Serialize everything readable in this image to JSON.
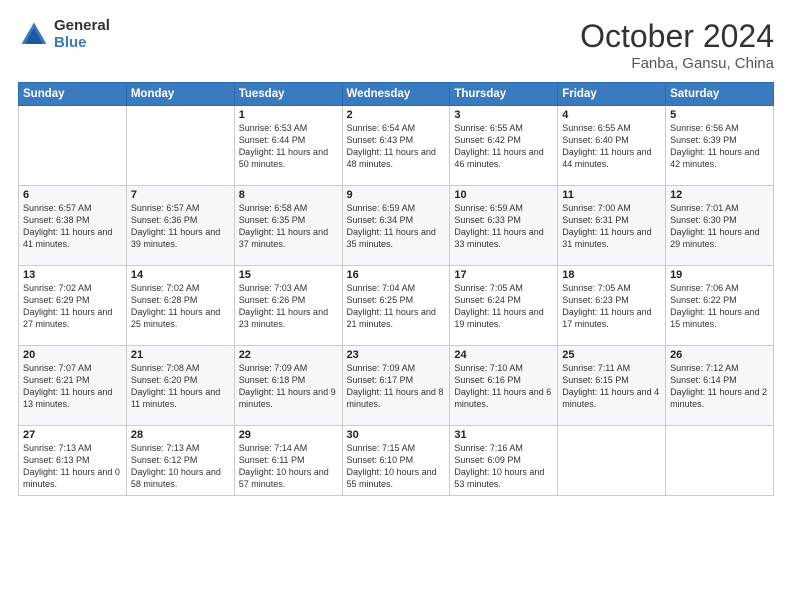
{
  "header": {
    "logo_general": "General",
    "logo_blue": "Blue",
    "month": "October 2024",
    "location": "Fanba, Gansu, China"
  },
  "days_of_week": [
    "Sunday",
    "Monday",
    "Tuesday",
    "Wednesday",
    "Thursday",
    "Friday",
    "Saturday"
  ],
  "weeks": [
    [
      {
        "day": "",
        "content": ""
      },
      {
        "day": "",
        "content": ""
      },
      {
        "day": "1",
        "content": "Sunrise: 6:53 AM\nSunset: 6:44 PM\nDaylight: 11 hours and 50 minutes."
      },
      {
        "day": "2",
        "content": "Sunrise: 6:54 AM\nSunset: 6:43 PM\nDaylight: 11 hours and 48 minutes."
      },
      {
        "day": "3",
        "content": "Sunrise: 6:55 AM\nSunset: 6:42 PM\nDaylight: 11 hours and 46 minutes."
      },
      {
        "day": "4",
        "content": "Sunrise: 6:55 AM\nSunset: 6:40 PM\nDaylight: 11 hours and 44 minutes."
      },
      {
        "day": "5",
        "content": "Sunrise: 6:56 AM\nSunset: 6:39 PM\nDaylight: 11 hours and 42 minutes."
      }
    ],
    [
      {
        "day": "6",
        "content": "Sunrise: 6:57 AM\nSunset: 6:38 PM\nDaylight: 11 hours and 41 minutes."
      },
      {
        "day": "7",
        "content": "Sunrise: 6:57 AM\nSunset: 6:36 PM\nDaylight: 11 hours and 39 minutes."
      },
      {
        "day": "8",
        "content": "Sunrise: 6:58 AM\nSunset: 6:35 PM\nDaylight: 11 hours and 37 minutes."
      },
      {
        "day": "9",
        "content": "Sunrise: 6:59 AM\nSunset: 6:34 PM\nDaylight: 11 hours and 35 minutes."
      },
      {
        "day": "10",
        "content": "Sunrise: 6:59 AM\nSunset: 6:33 PM\nDaylight: 11 hours and 33 minutes."
      },
      {
        "day": "11",
        "content": "Sunrise: 7:00 AM\nSunset: 6:31 PM\nDaylight: 11 hours and 31 minutes."
      },
      {
        "day": "12",
        "content": "Sunrise: 7:01 AM\nSunset: 6:30 PM\nDaylight: 11 hours and 29 minutes."
      }
    ],
    [
      {
        "day": "13",
        "content": "Sunrise: 7:02 AM\nSunset: 6:29 PM\nDaylight: 11 hours and 27 minutes."
      },
      {
        "day": "14",
        "content": "Sunrise: 7:02 AM\nSunset: 6:28 PM\nDaylight: 11 hours and 25 minutes."
      },
      {
        "day": "15",
        "content": "Sunrise: 7:03 AM\nSunset: 6:26 PM\nDaylight: 11 hours and 23 minutes."
      },
      {
        "day": "16",
        "content": "Sunrise: 7:04 AM\nSunset: 6:25 PM\nDaylight: 11 hours and 21 minutes."
      },
      {
        "day": "17",
        "content": "Sunrise: 7:05 AM\nSunset: 6:24 PM\nDaylight: 11 hours and 19 minutes."
      },
      {
        "day": "18",
        "content": "Sunrise: 7:05 AM\nSunset: 6:23 PM\nDaylight: 11 hours and 17 minutes."
      },
      {
        "day": "19",
        "content": "Sunrise: 7:06 AM\nSunset: 6:22 PM\nDaylight: 11 hours and 15 minutes."
      }
    ],
    [
      {
        "day": "20",
        "content": "Sunrise: 7:07 AM\nSunset: 6:21 PM\nDaylight: 11 hours and 13 minutes."
      },
      {
        "day": "21",
        "content": "Sunrise: 7:08 AM\nSunset: 6:20 PM\nDaylight: 11 hours and 11 minutes."
      },
      {
        "day": "22",
        "content": "Sunrise: 7:09 AM\nSunset: 6:18 PM\nDaylight: 11 hours and 9 minutes."
      },
      {
        "day": "23",
        "content": "Sunrise: 7:09 AM\nSunset: 6:17 PM\nDaylight: 11 hours and 8 minutes."
      },
      {
        "day": "24",
        "content": "Sunrise: 7:10 AM\nSunset: 6:16 PM\nDaylight: 11 hours and 6 minutes."
      },
      {
        "day": "25",
        "content": "Sunrise: 7:11 AM\nSunset: 6:15 PM\nDaylight: 11 hours and 4 minutes."
      },
      {
        "day": "26",
        "content": "Sunrise: 7:12 AM\nSunset: 6:14 PM\nDaylight: 11 hours and 2 minutes."
      }
    ],
    [
      {
        "day": "27",
        "content": "Sunrise: 7:13 AM\nSunset: 6:13 PM\nDaylight: 11 hours and 0 minutes."
      },
      {
        "day": "28",
        "content": "Sunrise: 7:13 AM\nSunset: 6:12 PM\nDaylight: 10 hours and 58 minutes."
      },
      {
        "day": "29",
        "content": "Sunrise: 7:14 AM\nSunset: 6:11 PM\nDaylight: 10 hours and 57 minutes."
      },
      {
        "day": "30",
        "content": "Sunrise: 7:15 AM\nSunset: 6:10 PM\nDaylight: 10 hours and 55 minutes."
      },
      {
        "day": "31",
        "content": "Sunrise: 7:16 AM\nSunset: 6:09 PM\nDaylight: 10 hours and 53 minutes."
      },
      {
        "day": "",
        "content": ""
      },
      {
        "day": "",
        "content": ""
      }
    ]
  ]
}
